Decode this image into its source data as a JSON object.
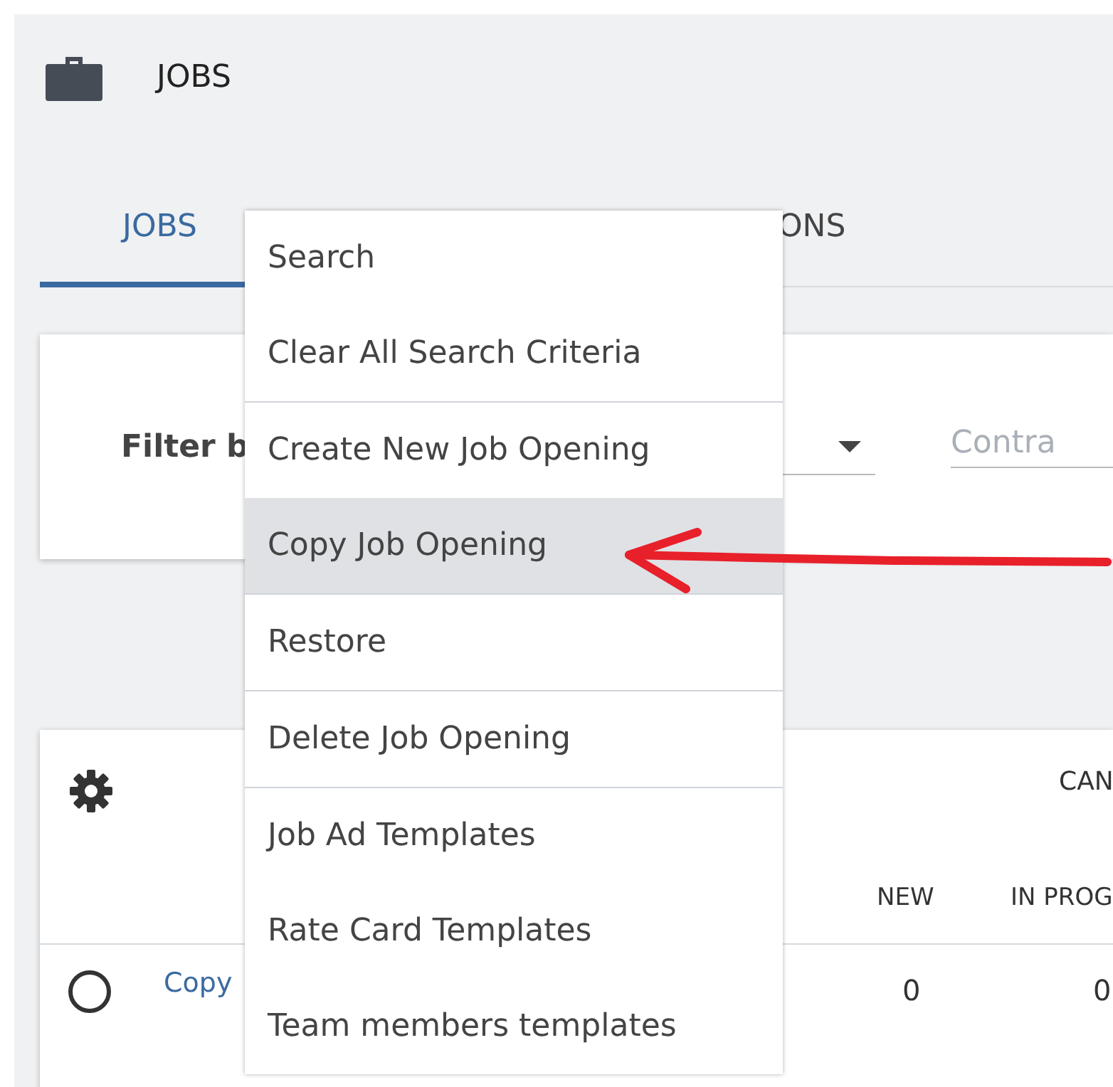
{
  "header": {
    "title": "JOBS"
  },
  "tabs": [
    {
      "label": "JOBS",
      "selected": true
    },
    {
      "label": "ONS",
      "selected": false
    }
  ],
  "filter": {
    "label": "Filter b",
    "contract_placeholder": "Contra"
  },
  "table": {
    "group_header": "CAN",
    "columns": [
      "NEW",
      "IN PROG"
    ],
    "rows": [
      {
        "selected": false,
        "link": "Copy",
        "new": "0",
        "in_progress": "0"
      }
    ]
  },
  "menu": {
    "groups": [
      [
        {
          "label": "Search",
          "selected": false
        },
        {
          "label": "Clear All Search Criteria",
          "selected": false
        }
      ],
      [
        {
          "label": "Create New Job Opening",
          "selected": false
        },
        {
          "label": "Copy Job Opening",
          "selected": true
        }
      ],
      [
        {
          "label": "Restore",
          "selected": false
        }
      ],
      [
        {
          "label": "Delete Job Opening",
          "selected": false
        }
      ],
      [
        {
          "label": "Job Ad Templates",
          "selected": false
        },
        {
          "label": "Rate Card Templates",
          "selected": false
        },
        {
          "label": "Team members templates",
          "selected": false
        }
      ]
    ]
  }
}
